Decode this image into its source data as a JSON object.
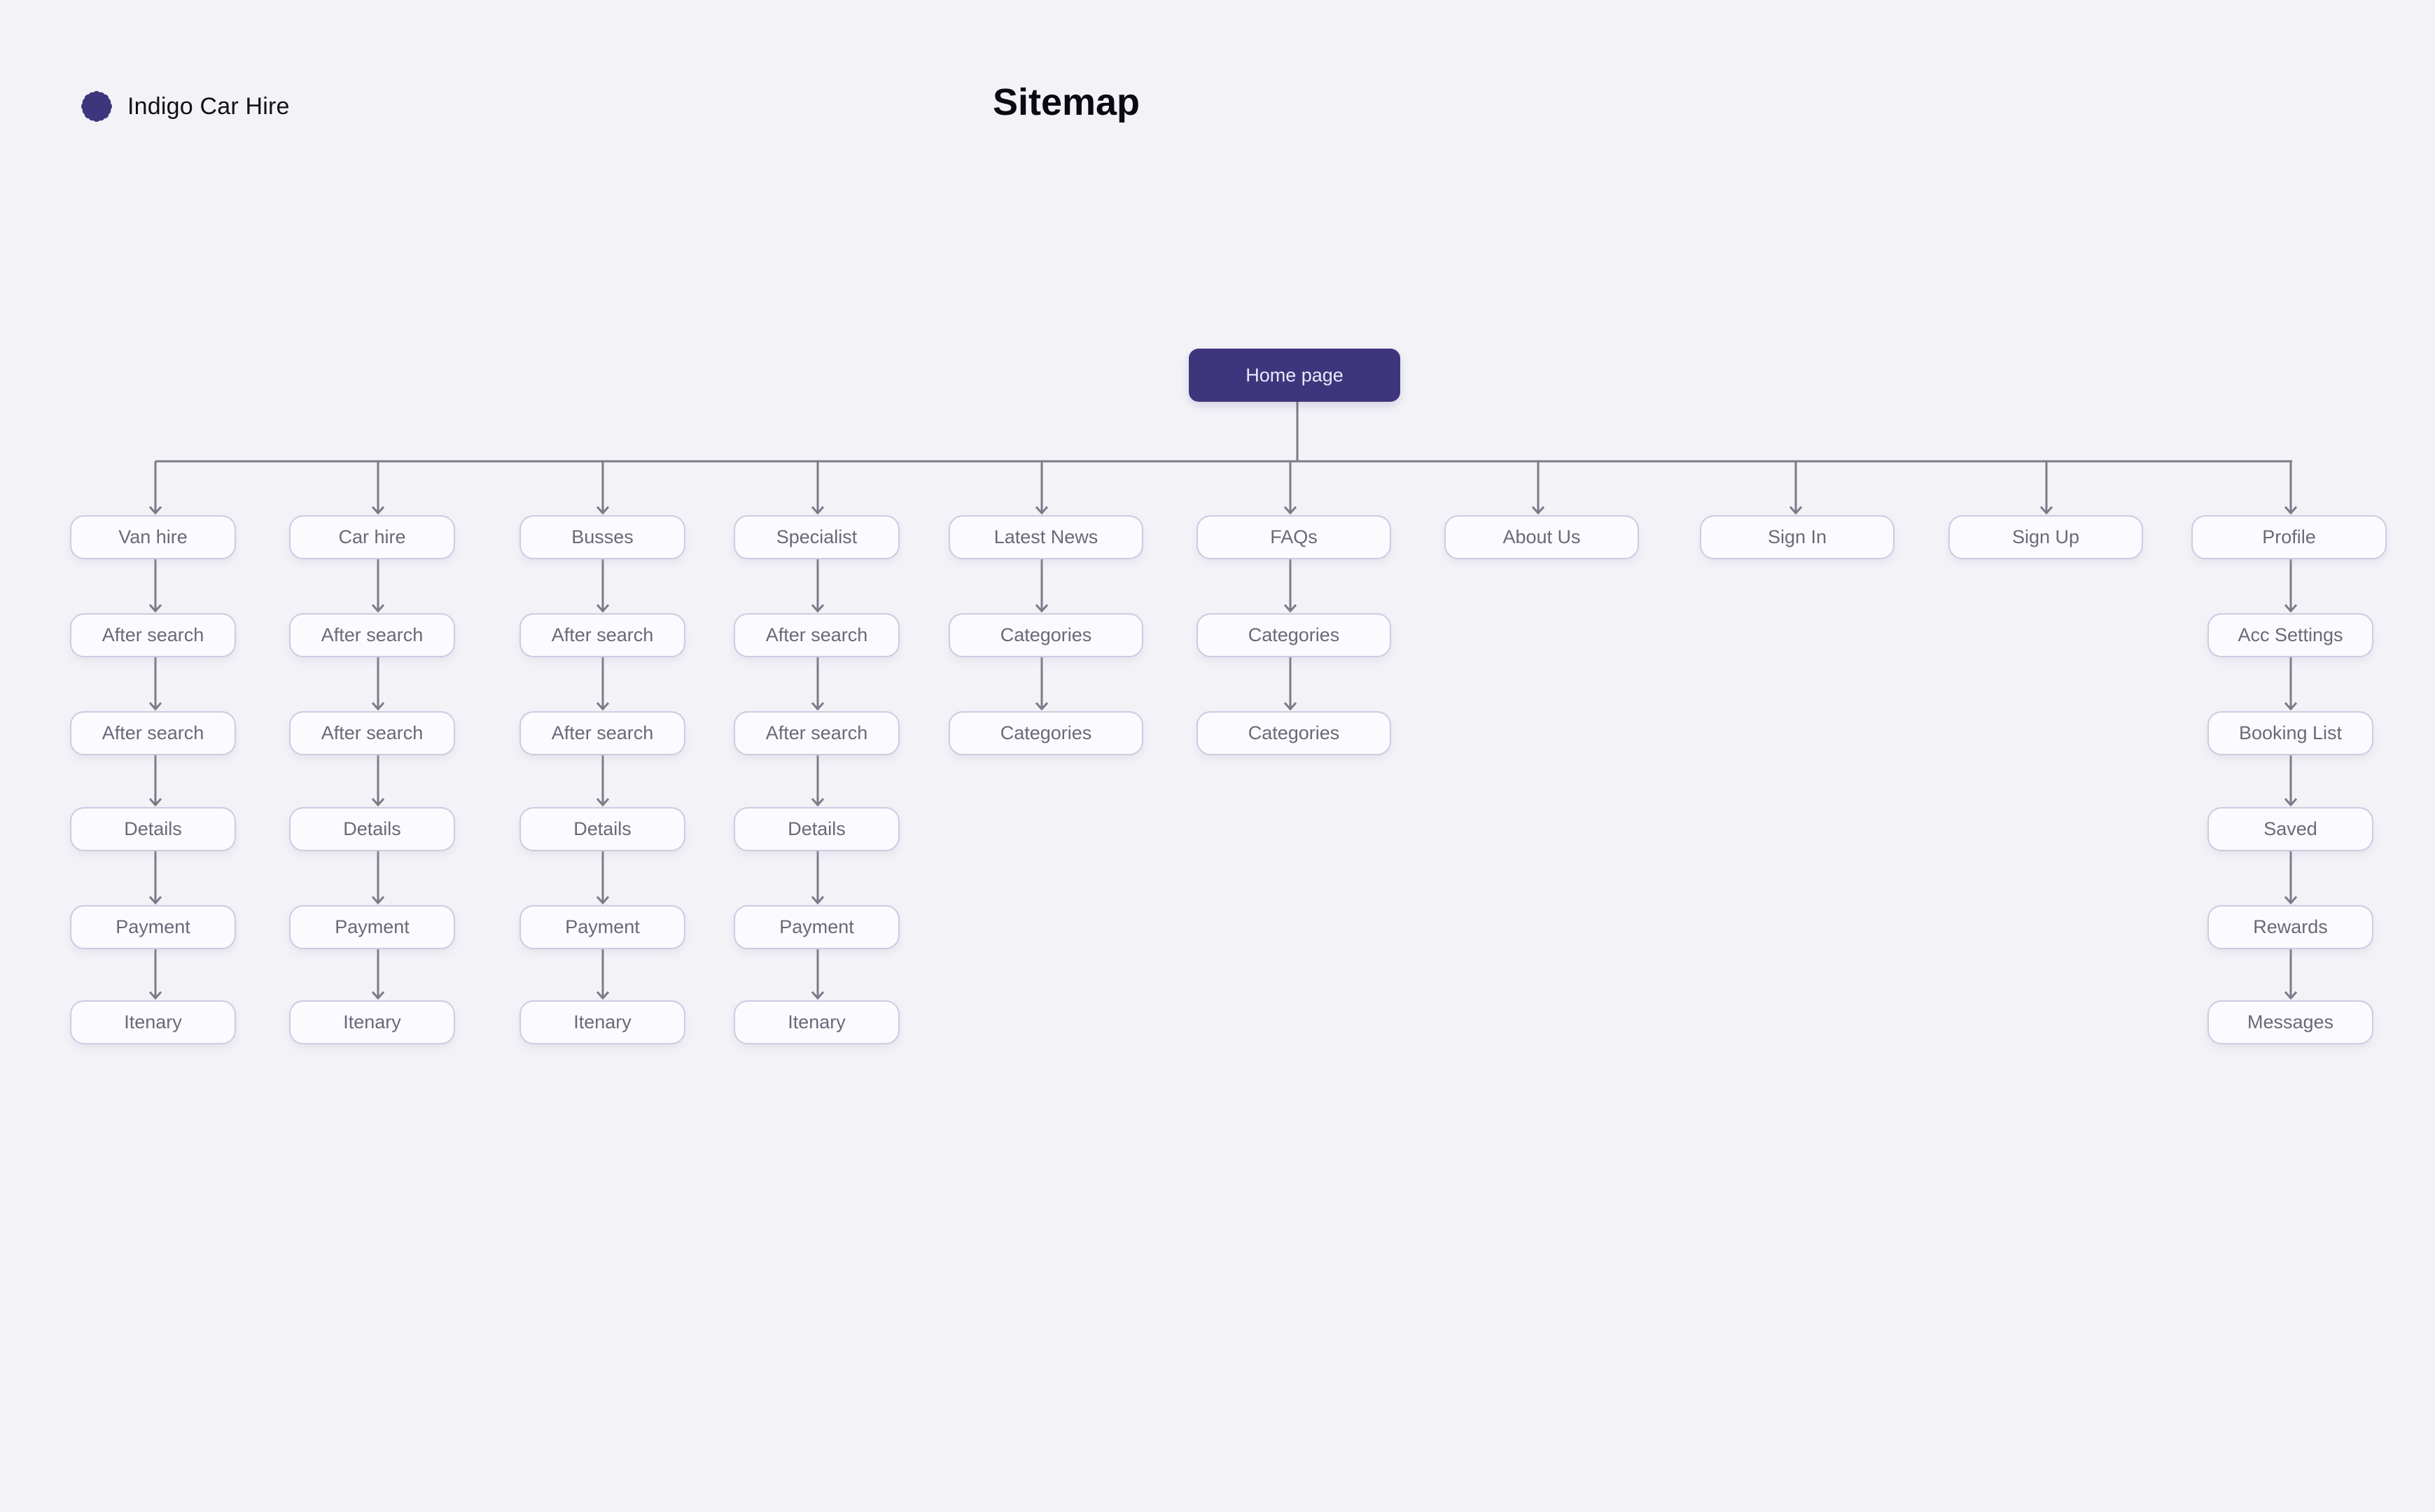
{
  "brand": {
    "name": "Indigo Car Hire",
    "icon": "flower-logo-icon",
    "color": "#3e367d"
  },
  "title": "Sitemap",
  "colors": {
    "root_fill": "#3e367d",
    "node_border": "#d2c8e2",
    "connector": "#7d7a88",
    "background": "#f3f2f7"
  },
  "root": {
    "label": "Home page"
  },
  "branches": [
    {
      "label": "Van hire",
      "children": [
        "After search",
        "After search",
        "Details",
        "Payment",
        "Itenary"
      ]
    },
    {
      "label": "Car hire",
      "children": [
        "After search",
        "After search",
        "Details",
        "Payment",
        "Itenary"
      ]
    },
    {
      "label": "Busses",
      "children": [
        "After search",
        "After search",
        "Details",
        "Payment",
        "Itenary"
      ]
    },
    {
      "label": "Specialist",
      "children": [
        "After search",
        "After search",
        "Details",
        "Payment",
        "Itenary"
      ]
    },
    {
      "label": "Latest News",
      "children": [
        "Categories",
        "Categories"
      ]
    },
    {
      "label": "FAQs",
      "children": [
        "Categories",
        "Categories"
      ]
    },
    {
      "label": "About Us",
      "children": []
    },
    {
      "label": "Sign In",
      "children": []
    },
    {
      "label": "Sign Up",
      "children": []
    },
    {
      "label": "Profile",
      "children": [
        "Acc Settings",
        "Booking List",
        "Saved",
        "Rewards",
        "Messages"
      ]
    }
  ]
}
